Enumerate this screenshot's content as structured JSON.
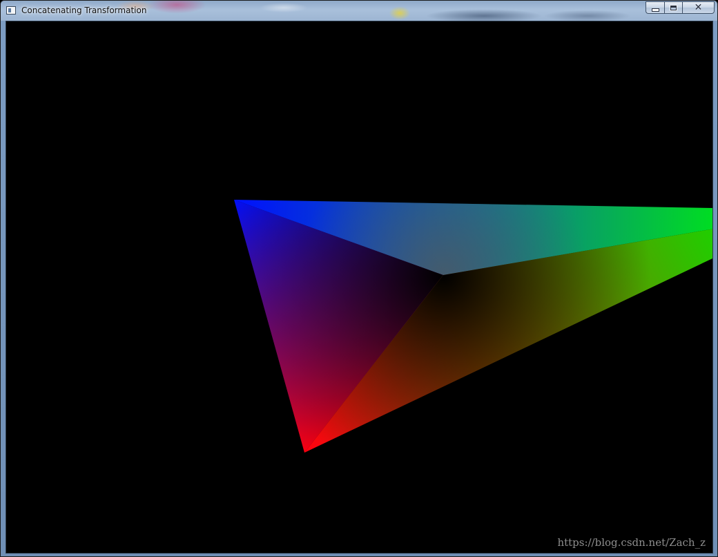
{
  "window": {
    "title": "Concatenating Transformation",
    "icon": "app-window-icon",
    "buttons": {
      "minimize_icon": "minimize-icon",
      "maximize_icon": "maximize-icon",
      "close_icon": "close-icon",
      "close_glyph": "✕"
    }
  },
  "scene": {
    "background": "#000000",
    "colors": {
      "blue": "#0010ff",
      "green": "#00dd22",
      "red": "#ff0010",
      "center_dark": "#000000"
    }
  },
  "watermark": "https://blog.csdn.net/Zach_z"
}
